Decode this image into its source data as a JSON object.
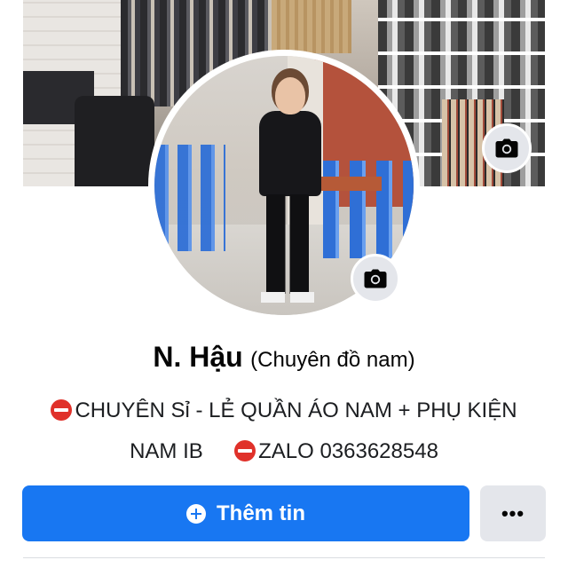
{
  "profile": {
    "name": "N. Hậu",
    "nickname": "(Chuyên đồ nam)",
    "bio_line1": "CHUYÊN Sỉ - LẺ QUẦN ÁO NAM + PHỤ KIỆN",
    "bio_line2_a": "NAM IB",
    "bio_line2_b": "ZALO 0363628548"
  },
  "icons": {
    "cover_camera": "camera-icon",
    "avatar_camera": "camera-icon",
    "bio_marker": "no-entry-icon",
    "add_story": "plus-circle-icon",
    "more": "more-dots-icon"
  },
  "actions": {
    "add_story_label": "Thêm tin",
    "more_label": "•••"
  },
  "colors": {
    "primary": "#1877f2",
    "secondary_button": "#e4e6eb",
    "no_entry_red": "#e0312a"
  }
}
